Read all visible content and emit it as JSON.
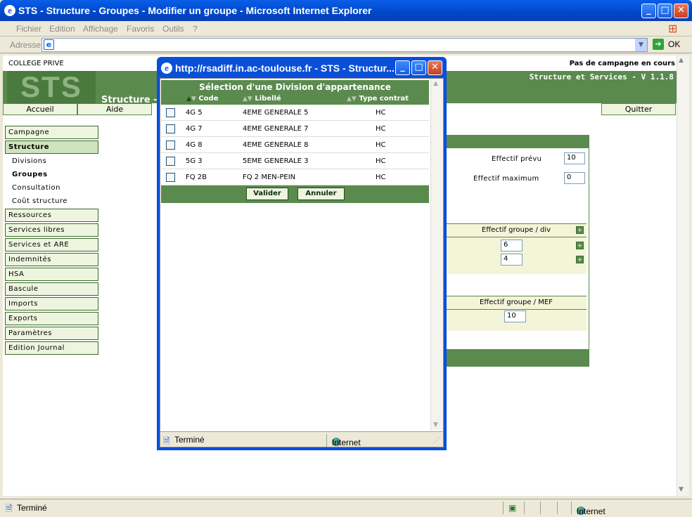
{
  "window": {
    "title": "STS - Structure - Groupes - Modifier un groupe - Microsoft Internet Explorer"
  },
  "menu": [
    "Fichier",
    "Edition",
    "Affichage",
    "Favoris",
    "Outils",
    "?"
  ],
  "address": {
    "label": "Adresse",
    "value": "",
    "go": "OK"
  },
  "page": {
    "school": "COLLEGE PRIVE",
    "campaign": "Pas de campagne en cours",
    "app_title": "Structure et Services - V 1.1.8",
    "logo": "STS",
    "section_title": "Structure -",
    "nav": {
      "home": "Accueil",
      "help": "Aide",
      "quit": "Quitter"
    },
    "sidebar": {
      "campagne": "Campagne",
      "structure": "Structure",
      "sub": [
        "Divisions",
        "Groupes",
        "Consultation",
        "Coût structure"
      ],
      "items": [
        "Ressources",
        "Services libres",
        "Services et ARE",
        "Indemnités",
        "HSA",
        "Bascule",
        "Imports",
        "Exports",
        "Paramètres",
        "Edition Journal"
      ]
    },
    "form": {
      "effectif_prevu_label": "Effectif prévu",
      "effectif_prevu": "10",
      "effectif_max_label": "Effectif maximum",
      "effectif_max": "0",
      "div_header": "Effectif groupe / div",
      "div_values": [
        "6",
        "4"
      ],
      "mef_header": "Effectif groupe / MEF",
      "mef_value": "10"
    }
  },
  "status": {
    "text": "Terminé",
    "zone": "Internet"
  },
  "popup": {
    "title": "http://rsadiff.in.ac-toulouse.fr - STS - Structur...",
    "heading": "Sélection d'une Division d'appartenance",
    "columns": {
      "code": "Code",
      "libelle": "Libellé",
      "type": "Type contrat"
    },
    "rows": [
      {
        "code": "4G 5",
        "libelle": "4EME GENERALE 5",
        "type": "HC"
      },
      {
        "code": "4G 7",
        "libelle": "4EME GENERALE 7",
        "type": "HC"
      },
      {
        "code": "4G 8",
        "libelle": "4EME GENERALE 8",
        "type": "HC"
      },
      {
        "code": "5G 3",
        "libelle": "5EME GENERALE 3",
        "type": "HC"
      },
      {
        "code": "FQ 2B",
        "libelle": "FQ 2 MEN-PEIN",
        "type": "HC"
      }
    ],
    "buttons": {
      "ok": "Valider",
      "cancel": "Annuler"
    },
    "status": {
      "text": "Terminé",
      "zone": "Internet"
    }
  },
  "colors": {
    "accent": "#5b8a4e",
    "xp_blue": "#0a4fd8"
  }
}
